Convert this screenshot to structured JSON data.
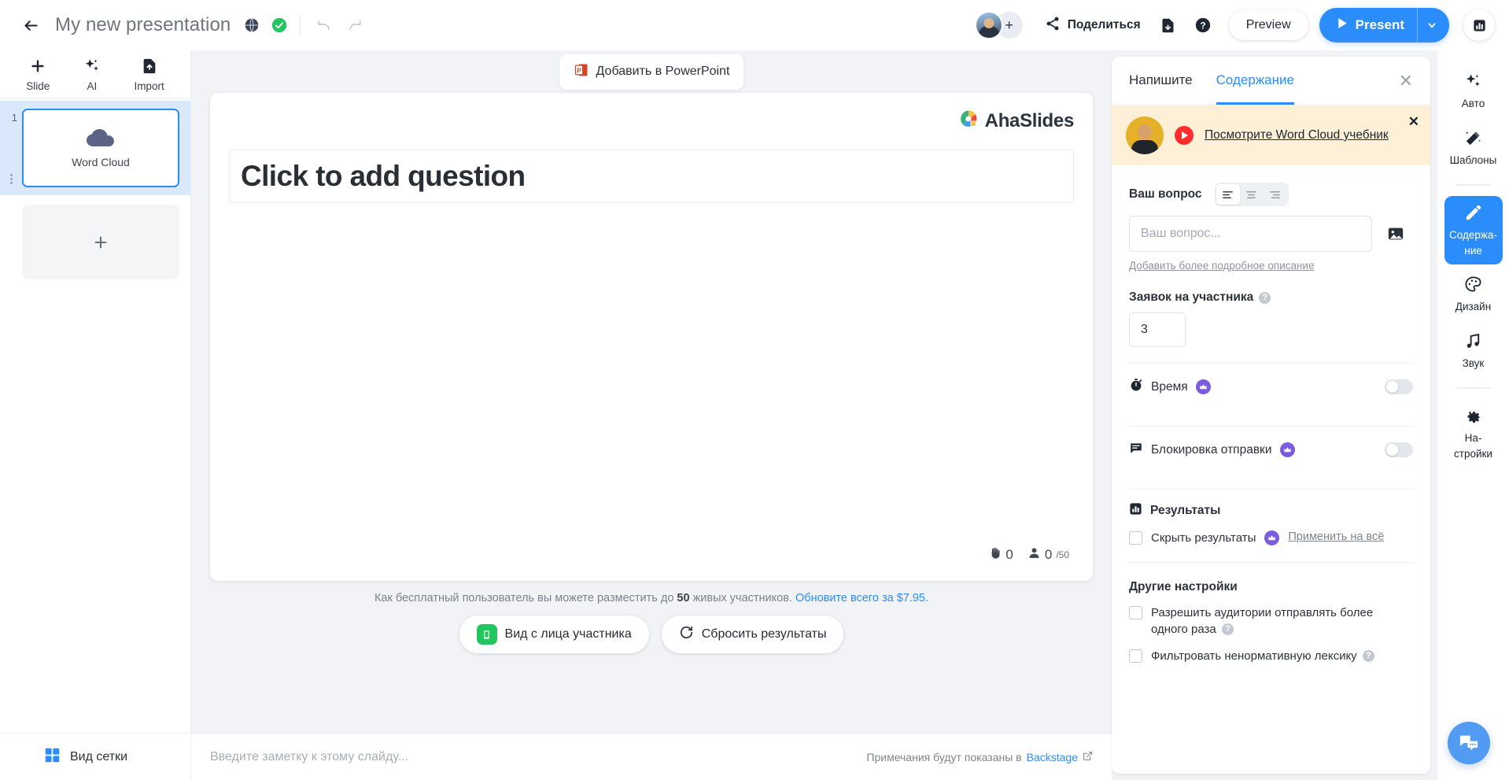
{
  "header": {
    "back_icon": "arrow-left-icon",
    "title": "My new presentation",
    "globe_icon": "globe-icon",
    "saved_icon": "check-circle-icon",
    "undo_icon": "undo-icon",
    "redo_icon": "redo-icon",
    "avatar_add": "+",
    "share_label": "Поделиться",
    "share_icon": "share-icon",
    "export_icon": "file-download-icon",
    "help_icon": "help-circle-icon",
    "preview_label": "Preview",
    "present_label": "Present",
    "present_caret_icon": "chevron-down-icon",
    "stats_icon": "bar-chart-icon",
    "accent_blue": "#2b8cfb",
    "saved_green": "#22c55e"
  },
  "left_panel": {
    "tools": [
      {
        "label": "Slide",
        "icon": "plus-icon"
      },
      {
        "label": "AI",
        "icon": "sparkles-icon"
      },
      {
        "label": "Import",
        "icon": "file-upload-icon"
      }
    ],
    "slides": [
      {
        "number": "1",
        "label": "Word Cloud",
        "icon": "cloud-icon",
        "active": true
      }
    ],
    "add_slide_icon": "plus-icon",
    "grid_view_label": "Вид сетки",
    "grid_view_icon": "grid-icon"
  },
  "center": {
    "powerpoint_button": "Добавить в PowerPoint",
    "powerpoint_icon": "powerpoint-icon",
    "brand": "AhaSlides",
    "brand_icon": "ahaslides-logo-icon",
    "question_placeholder": "Click to add question",
    "counters": {
      "hands_icon": "hand-icon",
      "hands_value": "0",
      "participants_icon": "person-icon",
      "participants_value": "0",
      "participants_max": "/50"
    },
    "free_note_prefix": "Как бесплатный пользователь вы можете разместить до ",
    "free_note_limit": "50",
    "free_note_suffix": " живых участников. ",
    "free_note_link": "Обновите всего за $7.95.",
    "actions": [
      {
        "label": "Вид с лица участника",
        "icon": "phone-icon"
      },
      {
        "label": "Сбросить результаты",
        "icon": "refresh-icon"
      }
    ],
    "notes_placeholder": "Введите заметку к этому слайду...",
    "notes_hint_prefix": "Примечания будут показаны в ",
    "notes_hint_link": "Backstage",
    "notes_hint_icon": "external-link-icon"
  },
  "right_panel": {
    "tabs": [
      {
        "label": "Напишите",
        "active": false
      },
      {
        "label": "Содержание",
        "active": true
      }
    ],
    "close_icon": "close-icon",
    "tutorial": {
      "link": "Посмотрите Word Cloud учебник",
      "play_icon": "youtube-play-icon",
      "close_icon": "close-icon",
      "avatar": "tutor-avatar",
      "background": "#fdf0d6"
    },
    "question": {
      "label": "Ваш вопрос",
      "align_options": [
        "align-left-icon",
        "align-center-icon",
        "align-right-icon"
      ],
      "align_active": 0,
      "placeholder": "Ваш вопрос...",
      "value": "",
      "image_icon": "image-icon",
      "more_description_link": "Добавить более подробное описание"
    },
    "entries": {
      "label": "Заявок на участника",
      "help_icon": "help-icon",
      "value": "3"
    },
    "toggles": [
      {
        "label": "Время",
        "icon": "timer-icon",
        "premium": true,
        "on": false
      },
      {
        "label": "Блокировка отправки",
        "icon": "comment-icon",
        "premium": true,
        "on": false
      }
    ],
    "results": {
      "label": "Результаты",
      "icon": "bar-chart-icon",
      "hide_results_label": "Скрыть результаты",
      "hide_results_checked": false,
      "hide_results_premium": true,
      "apply_all_label": "Применить на всё"
    },
    "other_settings": {
      "label": "Другие настройки",
      "options": [
        {
          "label": "Разрешить аудитории отправлять более одного раза",
          "checked": false,
          "has_help": true
        },
        {
          "label": "Фильтровать ненормативную лексику",
          "checked": false,
          "has_help": true
        }
      ]
    }
  },
  "rail": {
    "items": [
      {
        "label": "Авто",
        "icon": "sparkles-icon",
        "active": false
      },
      {
        "label": "Шаблоны",
        "icon": "magic-wand-icon",
        "active": false
      },
      {
        "label": "Содержа-\nние",
        "label_line1": "Содержа-",
        "label_line2": "ние",
        "icon": "pencil-icon",
        "active": true
      },
      {
        "label": "Дизайн",
        "icon": "palette-icon",
        "active": false
      },
      {
        "label": "Звук",
        "icon": "music-icon",
        "active": false
      },
      {
        "label": "На-\nстройки",
        "label_line1": "На-",
        "label_line2": "стройки",
        "icon": "gear-icon",
        "active": false
      }
    ]
  },
  "chat": {
    "icon": "chat-bubbles-icon",
    "color": "#519bf2"
  }
}
